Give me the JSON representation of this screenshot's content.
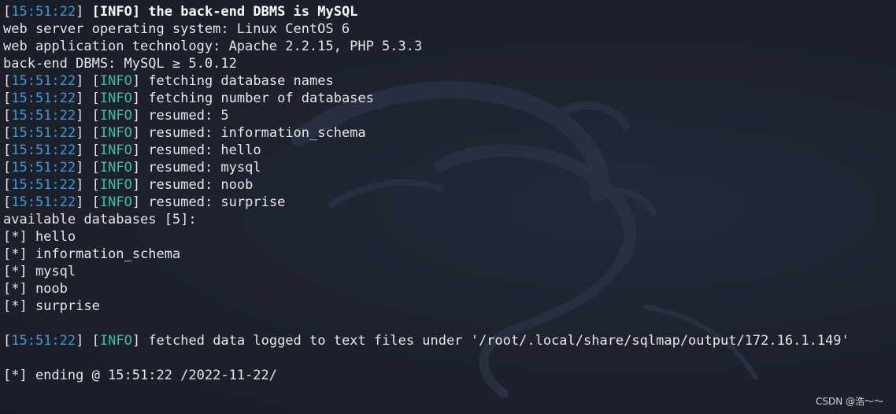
{
  "terminal": {
    "lines": [
      {
        "type": "log",
        "time": "15:51:22",
        "level": "INFO",
        "msg": "the back-end DBMS is MySQL",
        "bold": true
      },
      {
        "type": "plain",
        "text": "web server operating system: Linux CentOS 6"
      },
      {
        "type": "plain",
        "text": "web application technology: Apache 2.2.15, PHP 5.3.3"
      },
      {
        "type": "plain",
        "text": "back-end DBMS: MySQL ≥ 5.0.12"
      },
      {
        "type": "log",
        "time": "15:51:22",
        "level": "INFO",
        "msg": "fetching database names"
      },
      {
        "type": "log",
        "time": "15:51:22",
        "level": "INFO",
        "msg": "fetching number of databases"
      },
      {
        "type": "log",
        "time": "15:51:22",
        "level": "INFO",
        "msg": "resumed: 5"
      },
      {
        "type": "log",
        "time": "15:51:22",
        "level": "INFO",
        "msg": "resumed: information_schema"
      },
      {
        "type": "log",
        "time": "15:51:22",
        "level": "INFO",
        "msg": "resumed: hello"
      },
      {
        "type": "log",
        "time": "15:51:22",
        "level": "INFO",
        "msg": "resumed: mysql"
      },
      {
        "type": "log",
        "time": "15:51:22",
        "level": "INFO",
        "msg": "resumed: noob"
      },
      {
        "type": "log",
        "time": "15:51:22",
        "level": "INFO",
        "msg": "resumed: surprise"
      },
      {
        "type": "plain",
        "text": "available databases [5]:"
      },
      {
        "type": "plain",
        "text": "[*] hello"
      },
      {
        "type": "plain",
        "text": "[*] information_schema"
      },
      {
        "type": "plain",
        "text": "[*] mysql"
      },
      {
        "type": "plain",
        "text": "[*] noob"
      },
      {
        "type": "plain",
        "text": "[*] surprise"
      },
      {
        "type": "blank",
        "text": ""
      },
      {
        "type": "log",
        "time": "15:51:22",
        "level": "INFO",
        "msg": "fetched data logged to text files under '/root/.local/share/sqlmap/output/172.16.1.149'"
      },
      {
        "type": "blank",
        "text": ""
      },
      {
        "type": "plain",
        "text": "[*] ending @ 15:51:22 /2022-11-22/"
      }
    ]
  },
  "watermark": "CSDN @浩～～",
  "colors": {
    "background": "#1d222e",
    "timestamp": "#3a9bd6",
    "level_info": "#3cbfa4",
    "text": "#e6e6e6"
  },
  "background_icon": "kali-dragon-icon"
}
